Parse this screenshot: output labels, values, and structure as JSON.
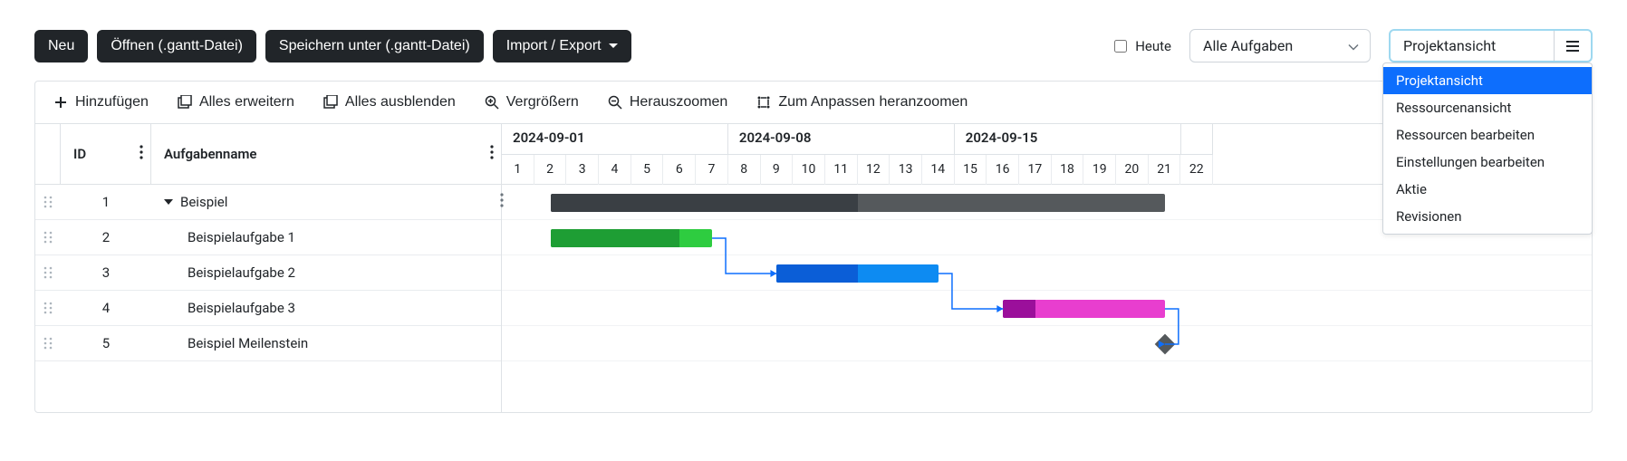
{
  "topbar": {
    "new": "Neu",
    "open": "Öffnen (.gantt-Datei)",
    "save": "Speichern unter (.gantt-Datei)",
    "import_export": "Import / Export",
    "today": "Heute",
    "task_filter": "Alle Aufgaben",
    "view_label": "Projektansicht"
  },
  "view_menu": [
    "Projektansicht",
    "Ressourcenansicht",
    "Ressourcen bearbeiten",
    "Einstellungen bearbeiten",
    "Aktie",
    "Revisionen"
  ],
  "toolbar": {
    "add": "Hinzufügen",
    "expand": "Alles erweitern",
    "collapse": "Alles ausblenden",
    "zoom_in": "Vergrößern",
    "zoom_out": "Herauszoomen",
    "zoom_fit": "Zum Anpassen heranzoomen"
  },
  "columns": {
    "id": "ID",
    "name": "Aufgabenname"
  },
  "timeline": {
    "weeks": [
      {
        "label": "2024-09-01",
        "days": 7
      },
      {
        "label": "2024-09-08",
        "days": 7
      },
      {
        "label": "2024-09-15",
        "days": 7
      },
      {
        "label": "",
        "days": 1
      }
    ],
    "days": [
      1,
      2,
      3,
      4,
      5,
      6,
      7,
      8,
      9,
      10,
      11,
      12,
      13,
      14,
      15,
      16,
      17,
      18,
      19,
      20,
      21,
      22
    ],
    "day_width": 35.7
  },
  "tasks": [
    {
      "id": 1,
      "name": "Beispiel",
      "indent": 0,
      "expandable": true,
      "type": "summary",
      "start": 2,
      "dur": 19,
      "progress": 0.5,
      "color": "#55595c",
      "prog_color": "#3a3f44"
    },
    {
      "id": 2,
      "name": "Beispielaufgabe 1",
      "indent": 1,
      "expandable": false,
      "type": "task",
      "start": 2,
      "dur": 5,
      "progress": 0.8,
      "color": "#2ecc40",
      "prog_color": "#1e9e34"
    },
    {
      "id": 3,
      "name": "Beispielaufgabe 2",
      "indent": 1,
      "expandable": false,
      "type": "task",
      "start": 9,
      "dur": 5,
      "progress": 0.5,
      "color": "#0d8bf2",
      "prog_color": "#0b5ed7"
    },
    {
      "id": 4,
      "name": "Beispielaufgabe 3",
      "indent": 1,
      "expandable": false,
      "type": "task",
      "start": 16,
      "dur": 5,
      "progress": 0.2,
      "color": "#e83ecf",
      "prog_color": "#9b0f9b"
    },
    {
      "id": 5,
      "name": "Beispiel Meilenstein",
      "indent": 1,
      "expandable": false,
      "type": "milestone",
      "start": 21,
      "dur": 0,
      "color": "#55595c"
    }
  ],
  "links": [
    {
      "from_end": 7,
      "from_row": 1,
      "to_start": 9,
      "to_row": 2
    },
    {
      "from_end": 14,
      "from_row": 2,
      "to_start": 16,
      "to_row": 3
    },
    {
      "from_end": 21,
      "from_row": 3,
      "to_start": 21,
      "to_row": 4
    }
  ],
  "icons": {
    "plus": "plus-icon",
    "expand": "expand-all-icon",
    "collapse": "collapse-all-icon",
    "zoom_in": "zoom-in-icon",
    "zoom_out": "zoom-out-icon",
    "zoom_fit": "zoom-fit-icon",
    "drag": "drag-handle-icon",
    "kebab": "kebab-icon",
    "burger": "burger-icon",
    "chev": "chevron-down-icon"
  }
}
